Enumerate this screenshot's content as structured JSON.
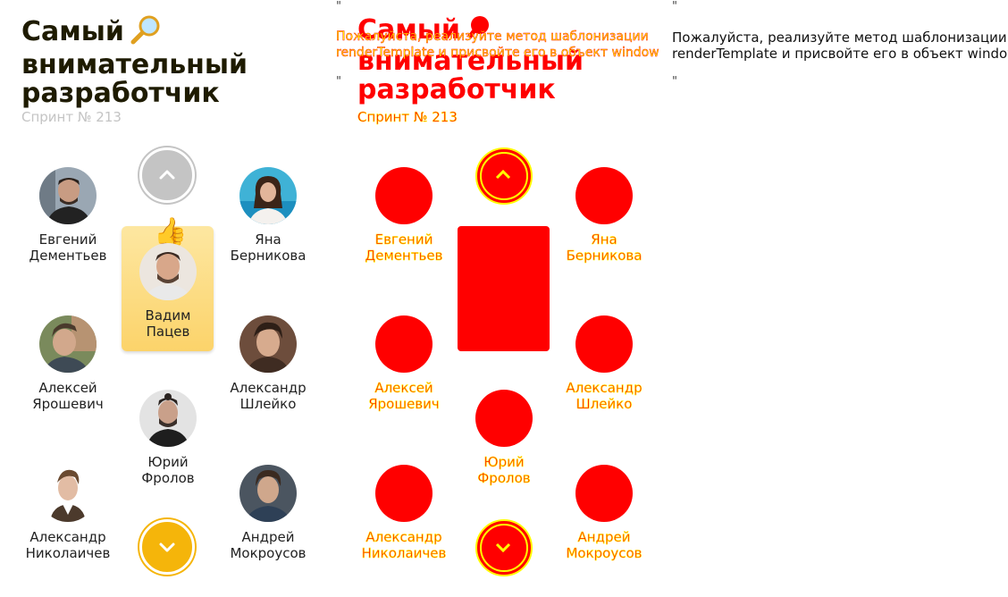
{
  "slide": {
    "title_lines": [
      "Самый",
      "внимательный",
      "разработчик"
    ],
    "title_emoji": "magnifier-icon",
    "subtitle": "Спринт № 213"
  },
  "leader": {
    "first": "Вадим",
    "last": "Пацев",
    "emoji": "👍"
  },
  "people": [
    {
      "first": "Евгений",
      "last": "Дементьев"
    },
    {
      "first": "Яна",
      "last": "Берникова"
    },
    {
      "first": "Алексей",
      "last": "Ярошевич"
    },
    {
      "first": "Александр",
      "last": "Шлейко"
    },
    {
      "first": "Юрий",
      "last": "Фролов"
    },
    {
      "first": "Александр",
      "last": "Николаичев"
    },
    {
      "first": "Андрей",
      "last": "Мокроусов"
    }
  ],
  "nav": {
    "up_icon": "chevron-up-icon",
    "down_icon": "chevron-down-icon"
  },
  "message": {
    "quote_open": "\"",
    "quote_close": "\"",
    "line1": "Пожалуйста, реализуйте метод шаблонизации",
    "line2": "renderTemplate и присвойте его в объект window"
  },
  "colors": {
    "accent": "#f5b50a",
    "disabled": "#c4c4c4",
    "diff_red": "#ff0000",
    "diff_yellow": "#ffff00"
  }
}
